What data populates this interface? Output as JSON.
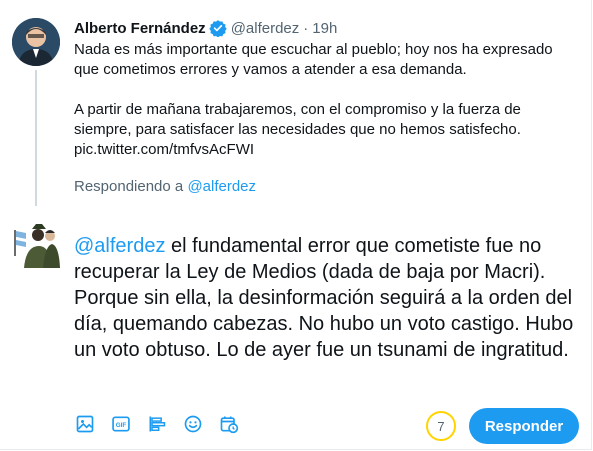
{
  "original_tweet": {
    "author_name": "Alberto Fernández",
    "handle": "@alferdez",
    "separator": "·",
    "time": "19h",
    "paragraph_1": "Nada es más importante que escuchar al pueblo; hoy nos ha expresado que cometimos errores y vamos a atender a esa demanda.",
    "paragraph_2": "A partir de mañana trabajaremos, con el compromiso y la fuerza de siempre, para satisfacer las necesidades que no hemos satisfecho.",
    "link": "pic.twitter.com/tmfvsAcFWI",
    "replying_prefix": "Respondiendo a",
    "replying_handle": "@alferdez"
  },
  "reply_draft": {
    "mention": "@alferdez",
    "text": " el fundamental error que cometiste fue no recuperar la Ley de Medios (dada de baja por Macri). Porque sin ella, la desinformación seguirá a la orden del día, quemando cabezas. No hubo un voto castigo. Hubo un voto obtuso. Lo de ayer fue un tsunami de ingratitud."
  },
  "toolbar": {
    "icons": [
      "image-icon",
      "gif-icon",
      "poll-icon",
      "emoji-icon",
      "schedule-icon"
    ],
    "gif_label": "GIF"
  },
  "char_counter": "7",
  "reply_button": "Responder",
  "colors": {
    "accent": "#1d9bf0",
    "counter_ring": "#ffd400",
    "thread_line": "#cfd9de",
    "secondary_text": "#536471"
  }
}
